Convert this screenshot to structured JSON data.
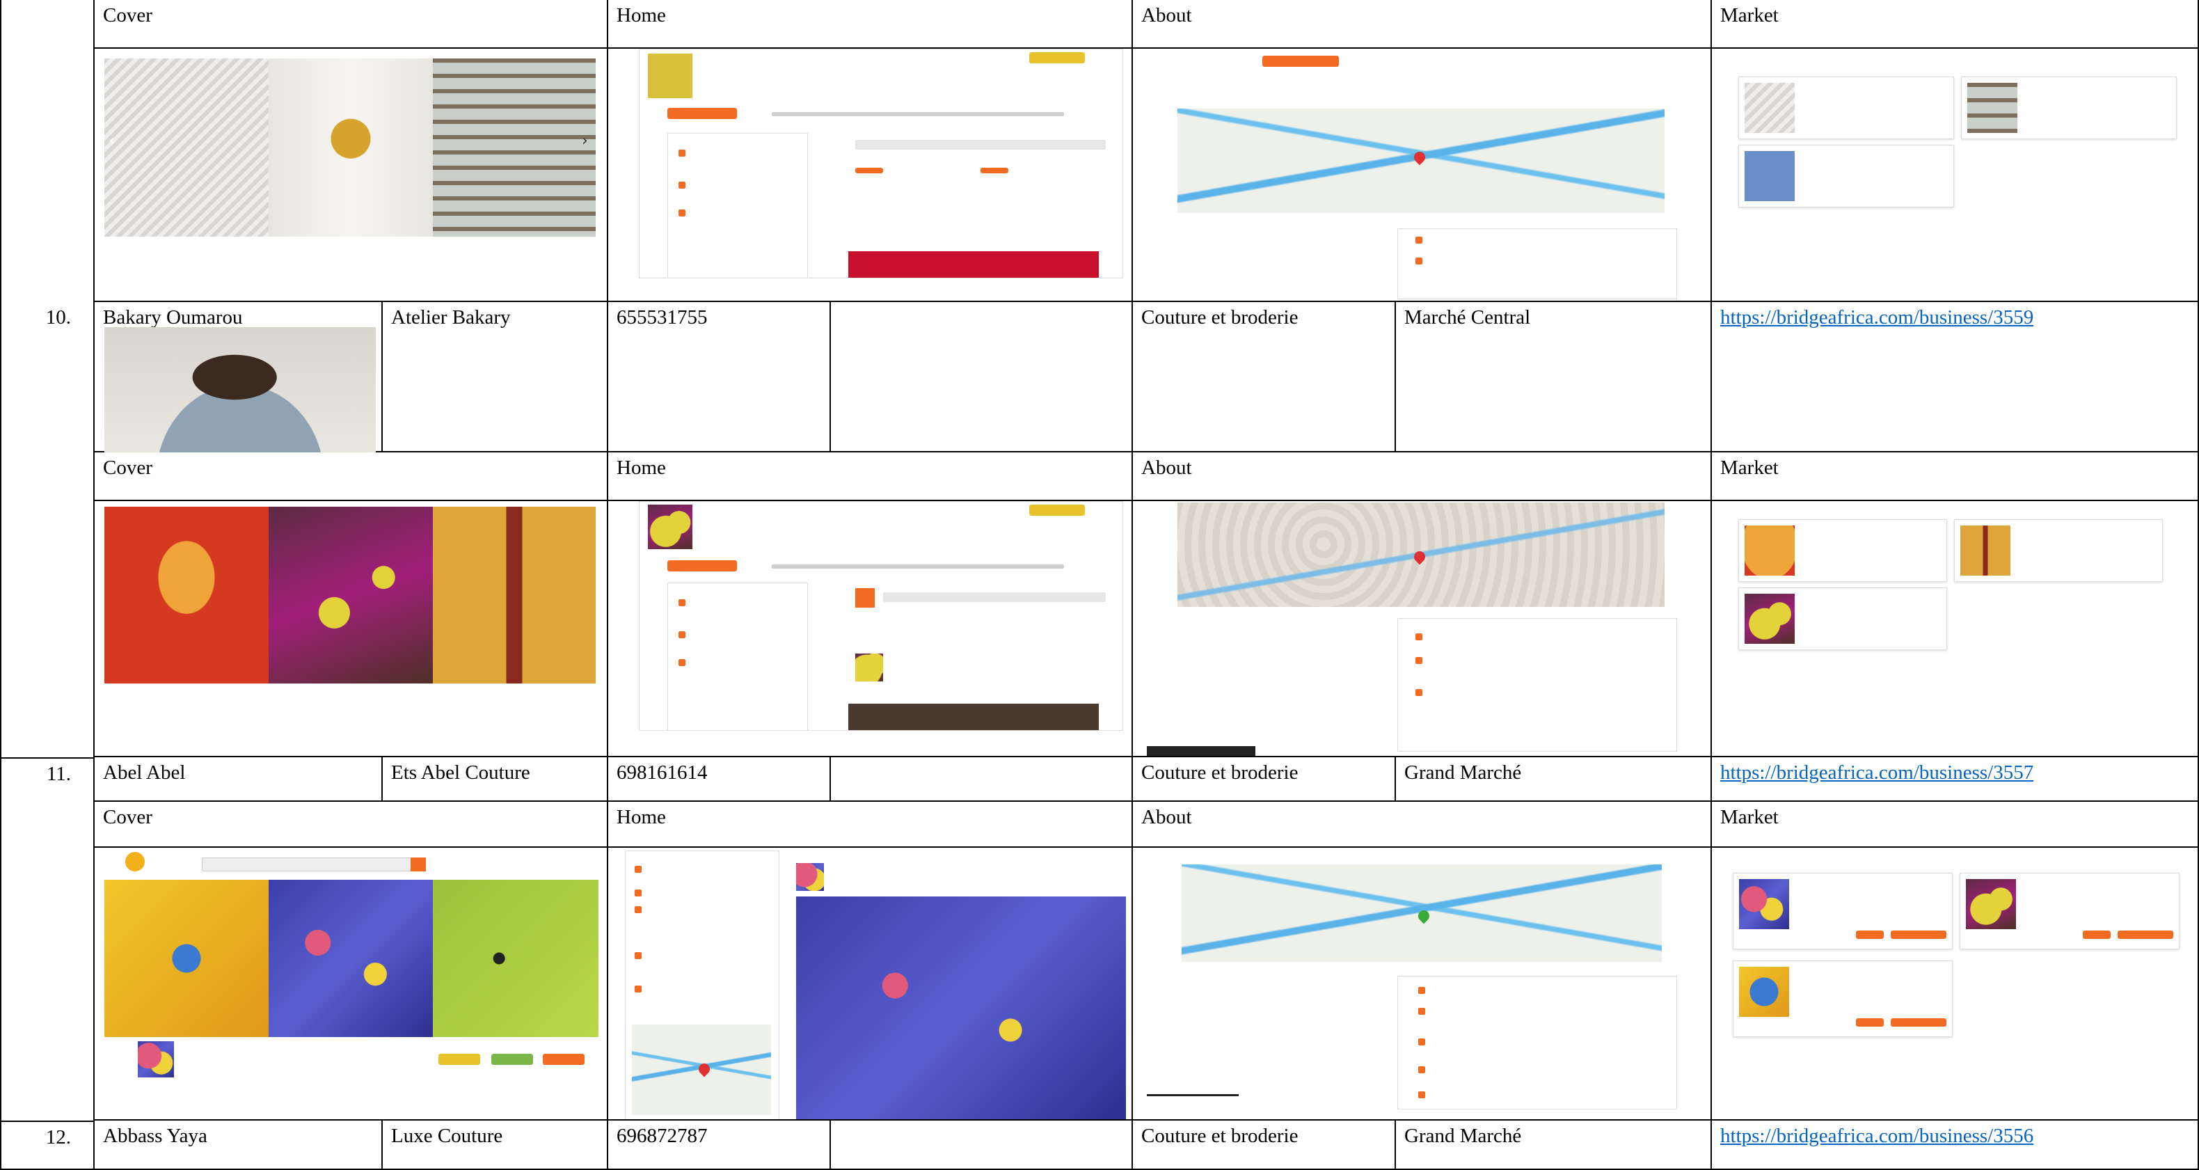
{
  "rows": [
    {
      "kind": "shots",
      "cover": "Cover",
      "home": "Home",
      "about": "About",
      "market": "Market"
    },
    {
      "kind": "entry",
      "number": "10.",
      "owner": "Bakary Oumarou",
      "business": "Atelier Bakary",
      "phone": "655531755",
      "category": "Couture et broderie",
      "location": "Marché Central",
      "url": "https://bridgeafrica.com/business/3559"
    },
    {
      "kind": "shots",
      "cover": "Cover",
      "home": "Home",
      "about": "About",
      "market": "Market"
    },
    {
      "kind": "entry",
      "number": "11.",
      "owner": "Abel Abel",
      "business": "Ets Abel Couture",
      "phone": "698161614",
      "category": "Couture et broderie",
      "location": "Grand Marché",
      "url": "https://bridgeafrica.com/business/3557"
    },
    {
      "kind": "shots",
      "cover": "Cover",
      "home": "Home",
      "about": "About",
      "market": "Market"
    },
    {
      "kind": "entry",
      "number": "12.",
      "owner": "Abbass Yaya",
      "business": "Luxe Couture",
      "phone": "696872787",
      "category": "Couture et broderie",
      "location": "Grand Marché",
      "url": "https://bridgeafrica.com/business/3556"
    }
  ],
  "colors": {
    "accent": "#f26b21",
    "link": "#0563c1",
    "highlight": "#e8c22a"
  }
}
